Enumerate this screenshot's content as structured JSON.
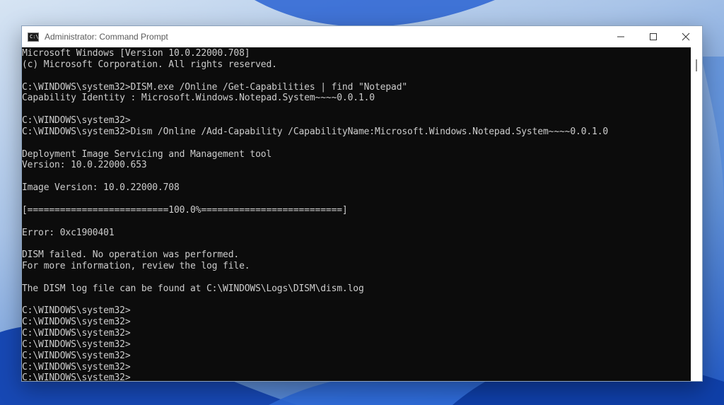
{
  "window": {
    "title": "Administrator: Command Prompt",
    "app_icon_text": "C:\\"
  },
  "terminal_lines": [
    "Microsoft Windows [Version 10.0.22000.708]",
    "(c) Microsoft Corporation. All rights reserved.",
    "",
    "C:\\WINDOWS\\system32>DISM.exe /Online /Get-Capabilities | find \"Notepad\"",
    "Capability Identity : Microsoft.Windows.Notepad.System~~~~0.0.1.0",
    "",
    "C:\\WINDOWS\\system32>",
    "C:\\WINDOWS\\system32>Dism /Online /Add-Capability /CapabilityName:Microsoft.Windows.Notepad.System~~~~0.0.1.0",
    "",
    "Deployment Image Servicing and Management tool",
    "Version: 10.0.22000.653",
    "",
    "Image Version: 10.0.22000.708",
    "",
    "[==========================100.0%==========================]",
    "",
    "Error: 0xc1900401",
    "",
    "DISM failed. No operation was performed.",
    "For more information, review the log file.",
    "",
    "The DISM log file can be found at C:\\WINDOWS\\Logs\\DISM\\dism.log",
    "",
    "C:\\WINDOWS\\system32>",
    "C:\\WINDOWS\\system32>",
    "C:\\WINDOWS\\system32>",
    "C:\\WINDOWS\\system32>",
    "C:\\WINDOWS\\system32>",
    "C:\\WINDOWS\\system32>",
    "C:\\WINDOWS\\system32>"
  ]
}
